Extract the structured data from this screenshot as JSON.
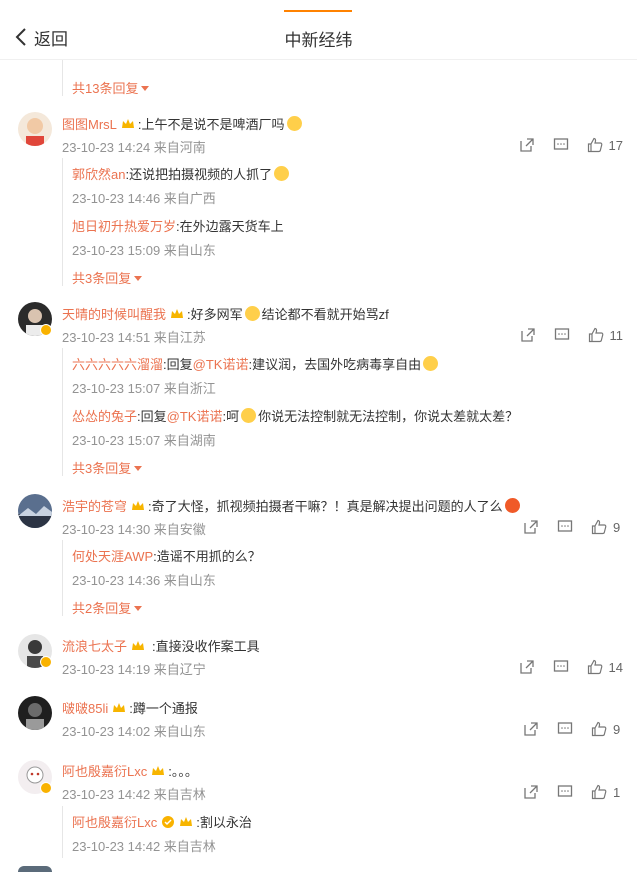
{
  "header": {
    "back_label": "返回",
    "title": "中新经纬"
  },
  "colors": {
    "accent": "#ff8200",
    "username": "#eb7350",
    "meta": "#939393"
  },
  "top_expand": "共13条回复",
  "comments": [
    {
      "user": "图图MrsL",
      "text": ":上午不是说不是啤酒厂吗",
      "time": "23-10-23 14:24 来自河南",
      "likes": "17",
      "replies": [
        {
          "user": "郭欣然an",
          "text": ":还说把拍摄视频的人抓了",
          "time": "23-10-23 14:46 来自广西"
        },
        {
          "user": "旭日初升热爱万岁",
          "text": ":在外边露天货车上",
          "time": "23-10-23 15:09 来自山东"
        }
      ],
      "expand": "共3条回复"
    },
    {
      "user": "天晴的时候叫醒我",
      "text_a": ":好多网军",
      "text_b": "结论都不看就开始骂zf",
      "time": "23-10-23 14:51 来自江苏",
      "likes": "11",
      "replies": [
        {
          "user": "六六六六六溜溜",
          "reply_prefix": ":回复",
          "mention": "@TK诺诺",
          "text": ":建议润，去国外吃病毒享自由",
          "time": "23-10-23 15:07 来自浙江"
        },
        {
          "user": "怂怂的兔子",
          "reply_prefix": ":回复",
          "mention": "@TK诺诺",
          "text_a": ":呵",
          "text_b": "你说无法控制就无法控制，你说太差就太差？",
          "time": "23-10-23 15:07 来自湖南"
        }
      ],
      "expand": "共3条回复"
    },
    {
      "user": "浩宇的苍穹",
      "text": ":奇了大怪，抓视频拍摄者干嘛？！真是解决提出问题的人了么",
      "time": "23-10-23 14:30 来自安徽",
      "likes": "9",
      "replies": [
        {
          "user": "何处天涯AWP",
          "text": ":造谣不用抓的么？",
          "time": "23-10-23 14:36 来自山东"
        }
      ],
      "expand": "共2条回复"
    },
    {
      "user": "流浪七太子",
      "text": ":直接没收作案工具",
      "time": "23-10-23 14:19 来自辽宁",
      "likes": "14"
    },
    {
      "user": "啵啵85li",
      "text": ":蹲一个通报",
      "time": "23-10-23 14:02 来自山东",
      "likes": "9"
    },
    {
      "user": "阿也殷嘉衍Lxc",
      "text": ":。。。",
      "time": "23-10-23 14:42 来自吉林",
      "likes": "1",
      "replies": [
        {
          "user": "阿也殷嘉衍Lxc",
          "text": ":割以永治",
          "time": "23-10-23 14:42 来自吉林"
        }
      ]
    }
  ]
}
